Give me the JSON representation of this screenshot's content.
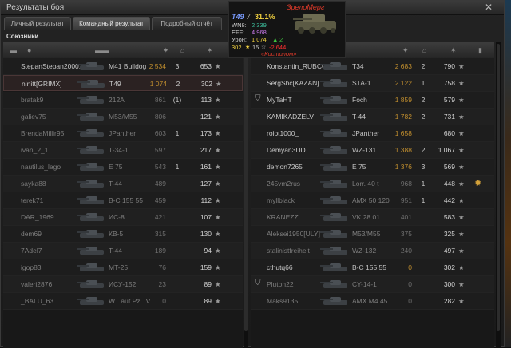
{
  "window": {
    "title": "Результаты боя",
    "close_icon": "close-icon"
  },
  "tabs": [
    {
      "label": "Личный результат",
      "active": false
    },
    {
      "label": "Командный результат",
      "active": true
    },
    {
      "label": "Подробный отчёт",
      "active": false
    }
  ],
  "subheader": "Союзники",
  "popup": {
    "player_name": "ЗрелоМерг",
    "tank": "T49",
    "winrate": "31.1%",
    "wn8_label": "WN8:",
    "wn8": "2 339",
    "eff_label": "EFF:",
    "eff": "4 968",
    "damage_label": "Урон:",
    "damage": "1 074",
    "frags": "2",
    "stat_a": "302",
    "stat_b": "15",
    "stat_c": "-2 644",
    "clan": "«Костолом»",
    "colors": {
      "name": "#e13a2a",
      "tank": "#7a9cff",
      "wn8": "#3ec2a0",
      "eff": "#cf7cf0",
      "damage": "#f0d040",
      "frags": "#3ec23e",
      "neg": "#ff3030",
      "clan": "#e13a2a"
    }
  },
  "columns": {
    "left": [
      "squad-icon",
      "player-icon",
      "tank-icon",
      "damage-icon",
      "frags-icon",
      "xp-icon"
    ],
    "right": [
      "xp-icon",
      "frags-icon",
      "damage-icon",
      "tank-icon",
      "player-icon",
      "squad-icon"
    ]
  },
  "left_team": [
    {
      "name": "StepanStepan2000...",
      "tank": "M41 Bulldog",
      "damage": "2 534",
      "frags": "3",
      "xp": "653",
      "alive": true,
      "hl": false
    },
    {
      "name": "ninitt[GRIMX]",
      "tank": "T49",
      "damage": "1 074",
      "frags": "2",
      "xp": "302",
      "alive": true,
      "hl": true
    },
    {
      "name": "bratak9",
      "tank": "212A",
      "damage": "861",
      "frags": "(1)",
      "xp": "113",
      "alive": false,
      "hl": false
    },
    {
      "name": "galiev75",
      "tank": "M53/M55",
      "damage": "806",
      "frags": "",
      "xp": "121",
      "alive": false,
      "hl": false
    },
    {
      "name": "BrendaMillir95",
      "tank": "JPanther",
      "damage": "603",
      "frags": "1",
      "xp": "173",
      "alive": false,
      "hl": false
    },
    {
      "name": "ivan_2_1",
      "tank": "T-34-1",
      "damage": "597",
      "frags": "",
      "xp": "217",
      "alive": false,
      "hl": false
    },
    {
      "name": "nautilus_lego",
      "tank": "E 75",
      "damage": "543",
      "frags": "1",
      "xp": "161",
      "alive": false,
      "hl": false
    },
    {
      "name": "sayka88",
      "tank": "T-44",
      "damage": "489",
      "frags": "",
      "xp": "127",
      "alive": false,
      "hl": false
    },
    {
      "name": "terek71",
      "tank": "B-C 155 55",
      "damage": "459",
      "frags": "",
      "xp": "112",
      "alive": false,
      "hl": false
    },
    {
      "name": "DAR_1969",
      "tank": "ИС-8",
      "damage": "421",
      "frags": "",
      "xp": "107",
      "alive": false,
      "hl": false
    },
    {
      "name": "dem69",
      "tank": "КВ-5",
      "damage": "315",
      "frags": "",
      "xp": "130",
      "alive": false,
      "hl": false
    },
    {
      "name": "7Adel7",
      "tank": "T-44",
      "damage": "189",
      "frags": "",
      "xp": "94",
      "alive": false,
      "hl": false
    },
    {
      "name": "igop83",
      "tank": "MT-25",
      "damage": "76",
      "frags": "",
      "xp": "159",
      "alive": false,
      "hl": false
    },
    {
      "name": "valeri2876",
      "tank": "ИСУ-152",
      "damage": "23",
      "frags": "",
      "xp": "89",
      "alive": false,
      "hl": false
    },
    {
      "name": "_BALU_63",
      "tank": "WT auf Pz. IV",
      "damage": "0",
      "frags": "",
      "xp": "89",
      "alive": false,
      "hl": false
    }
  ],
  "right_team": [
    {
      "name": "Konstantin_RUBCOF...",
      "tank": "T34",
      "damage": "2 683",
      "frags": "2",
      "xp": "790",
      "alive": true,
      "icon": ""
    },
    {
      "name": "SergShc[KAZAN]",
      "tank": "STA-1",
      "damage": "2 122",
      "frags": "1",
      "xp": "758",
      "alive": true,
      "icon": ""
    },
    {
      "name": "MyTaHT",
      "tank": "Foch",
      "damage": "1 859",
      "frags": "2",
      "xp": "579",
      "alive": true,
      "icon": "shield"
    },
    {
      "name": "KAMIKADZELV",
      "tank": "T-44",
      "damage": "1 782",
      "frags": "2",
      "xp": "731",
      "alive": true,
      "icon": ""
    },
    {
      "name": "roiot1000_",
      "tank": "JPanther",
      "damage": "1 658",
      "frags": "",
      "xp": "680",
      "alive": true,
      "icon": ""
    },
    {
      "name": "Demyan3DD",
      "tank": "WZ-131",
      "damage": "1 388",
      "frags": "2",
      "xp": "1 067",
      "alive": true,
      "icon": ""
    },
    {
      "name": "demon7265",
      "tank": "E 75",
      "damage": "1 376",
      "frags": "3",
      "xp": "569",
      "alive": true,
      "icon": ""
    },
    {
      "name": "245vm2rus",
      "tank": "Lorr. 40 t",
      "damage": "968",
      "frags": "1",
      "xp": "448",
      "alive": false,
      "icon": ""
    },
    {
      "name": "myllblack",
      "tank": "AMX 50 120",
      "damage": "951",
      "frags": "1",
      "xp": "442",
      "alive": false,
      "icon": ""
    },
    {
      "name": "KRANEZZ",
      "tank": "VK 28.01",
      "damage": "401",
      "frags": "",
      "xp": "583",
      "alive": false,
      "icon": ""
    },
    {
      "name": "Aleksei1950[ULY]",
      "tank": "M53/M55",
      "damage": "375",
      "frags": "",
      "xp": "325",
      "alive": false,
      "icon": ""
    },
    {
      "name": "stalinistfreiheit",
      "tank": "WZ-132",
      "damage": "240",
      "frags": "",
      "xp": "497",
      "alive": false,
      "icon": ""
    },
    {
      "name": "cthutq66",
      "tank": "B-C 155 55",
      "damage": "0",
      "frags": "",
      "xp": "302",
      "alive": true,
      "icon": ""
    },
    {
      "name": "Pluton22",
      "tank": "CY-14-1",
      "damage": "0",
      "frags": "",
      "xp": "300",
      "alive": false,
      "icon": "shield"
    },
    {
      "name": "Maks9135",
      "tank": "AMX M4 45",
      "damage": "0",
      "frags": "",
      "xp": "282",
      "alive": false,
      "icon": ""
    }
  ],
  "star_glyph": "★",
  "medal_icon": "medal-icon"
}
